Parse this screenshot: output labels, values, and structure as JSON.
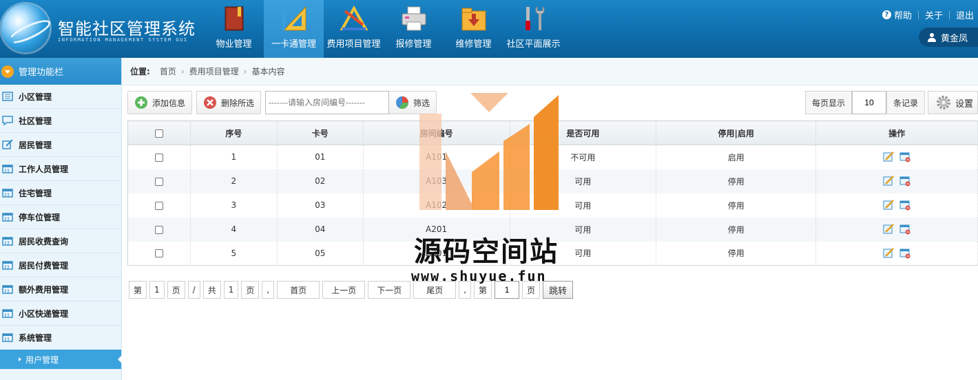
{
  "app": {
    "title": "智能社区管理系统",
    "subtitle": "INFORMATION MANAGEMENT SYSTEM GUI"
  },
  "topnav": [
    {
      "label": "物业管理",
      "icon": "book-icon",
      "active": false
    },
    {
      "label": "一卡通管理",
      "icon": "ruler-triangle-icon",
      "active": true
    },
    {
      "label": "费用项目管理",
      "icon": "drafting-tools-icon",
      "active": false
    },
    {
      "label": "报修管理",
      "icon": "printer-icon",
      "active": false
    },
    {
      "label": "维修管理",
      "icon": "download-folder-icon",
      "active": false
    },
    {
      "label": "社区平面展示",
      "icon": "tools-icon",
      "active": false
    }
  ],
  "header_links": {
    "help": "帮助",
    "about": "关于",
    "logout": "退出"
  },
  "user": {
    "name": "黄金凤"
  },
  "sidebar": {
    "title": "管理功能栏",
    "items": [
      {
        "label": "小区管理",
        "icon": "list-icon"
      },
      {
        "label": "社区管理",
        "icon": "chat-icon"
      },
      {
        "label": "居民管理",
        "icon": "edit-icon"
      },
      {
        "label": "工作人员管理",
        "icon": "calendar-icon"
      },
      {
        "label": "住宅管理",
        "icon": "calendar-icon"
      },
      {
        "label": "停车位管理",
        "icon": "calendar-icon"
      },
      {
        "label": "居民收费查询",
        "icon": "calendar-icon"
      },
      {
        "label": "居民付费管理",
        "icon": "calendar-icon"
      },
      {
        "label": "额外费用管理",
        "icon": "calendar-icon"
      },
      {
        "label": "小区快递管理",
        "icon": "calendar-icon"
      },
      {
        "label": "系统管理",
        "icon": "calendar-icon"
      }
    ],
    "active_sub": "用户管理"
  },
  "breadcrumb": {
    "label": "位置:",
    "items": [
      "首页",
      "费用项目管理",
      "基本内容"
    ]
  },
  "toolbar": {
    "add": "添加信息",
    "delete": "删除所选",
    "search_placeholder": "-------请输入房间编号-------",
    "filter": "筛选"
  },
  "page_size": {
    "label": "每页显示",
    "value": "10",
    "unit": "条记录"
  },
  "settings_label": "设置",
  "table": {
    "headers": [
      "序号",
      "卡号",
      "房间编号",
      "是否可用",
      "停用|启用",
      "操作"
    ],
    "rows": [
      {
        "no": "1",
        "card": "01",
        "room": "A101",
        "available": "不可用",
        "toggle": "启用"
      },
      {
        "no": "2",
        "card": "02",
        "room": "A103",
        "available": "可用",
        "toggle": "停用"
      },
      {
        "no": "3",
        "card": "03",
        "room": "A102",
        "available": "可用",
        "toggle": "停用"
      },
      {
        "no": "4",
        "card": "04",
        "room": "A201",
        "available": "可用",
        "toggle": "停用"
      },
      {
        "no": "5",
        "card": "05",
        "room": "A301",
        "available": "可用",
        "toggle": "停用"
      }
    ]
  },
  "pager": {
    "di": "第",
    "current": "1",
    "ye": "页",
    "slash": "/",
    "gong": "共",
    "total": "1",
    "ye2": "页",
    "comma": ",",
    "first": "首页",
    "prev": "上一页",
    "next": "下一页",
    "last": "尾页",
    "comma2": ",",
    "di2": "第",
    "goto_value": "1",
    "ye3": "页",
    "go": "跳转"
  },
  "watermark": {
    "text": "源码空间站",
    "url": "www.shuyue.fun"
  },
  "colors": {
    "header": "#0f6fae",
    "accent": "#3aa3dd",
    "unavailable": "#d0021b",
    "available": "#2e8b2e"
  }
}
